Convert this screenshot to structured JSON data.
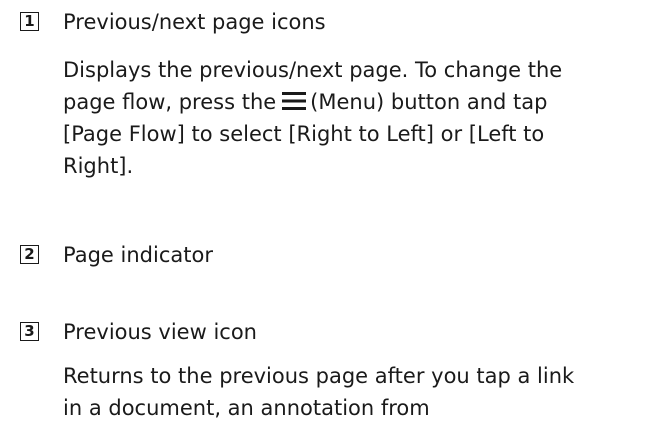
{
  "items": [
    {
      "number": "1",
      "title": "Previous/next page icons",
      "description_lines": {
        "line1": "Displays the previous/next page. To change the",
        "line2_before": "page flow, press the",
        "line2_after": "(Menu) button and tap",
        "line3": "[Page Flow] to select [Right to Left] or [Left to",
        "line4": "Right]."
      },
      "icon": "menu-icon"
    },
    {
      "number": "2",
      "title": "Page indicator"
    },
    {
      "number": "3",
      "title": "Previous view icon",
      "description_lines": {
        "line1": "Returns to the previous page after you tap a link",
        "line2": "in a document, an annotation from"
      }
    }
  ]
}
